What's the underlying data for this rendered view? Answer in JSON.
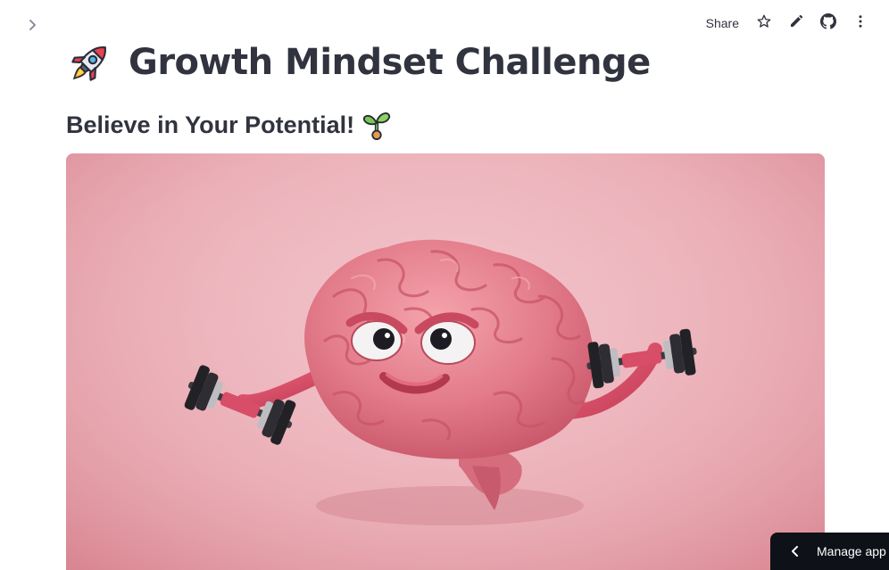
{
  "toolbar": {
    "share_label": "Share"
  },
  "icons": {
    "sidebar_toggle": "chevron-right-icon",
    "star": "star-icon",
    "edit": "pencil-icon",
    "github": "github-icon",
    "menu": "more-vertical-icon",
    "title_emoji": "rocket-icon",
    "subtitle_emoji": "seedling-icon",
    "manage_chevron": "chevron-left-icon"
  },
  "main": {
    "title": "Growth Mindset Challenge",
    "subtitle": "Believe in Your Potential!"
  },
  "hero": {
    "image": "brain-lifting-dumbbells-illustration"
  },
  "manage_app": {
    "label": "Manage app"
  },
  "colors": {
    "text": "#31333f",
    "hero_bg": "#ebb0b8",
    "brain": "#e8808f",
    "manage_bg": "#0e1117"
  }
}
